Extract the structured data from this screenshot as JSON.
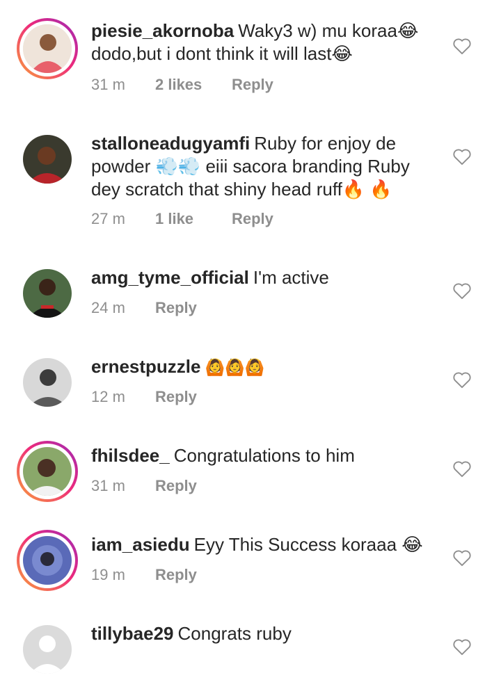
{
  "comments": [
    {
      "username": "piesie_akornoba",
      "text": "Waky3 w) mu koraa😂 dodo,but i dont think it will last😂",
      "time": "31 m",
      "likes": "2 likes",
      "reply": "Reply",
      "avatar_color": "#e8a87c",
      "story_ring": true
    },
    {
      "username": "stalloneadugyamfi",
      "text": "Ruby for enjoy de powder 💨💨 eiii sacora branding Ruby dey scratch that shiny head ruff🔥 🔥",
      "time": "27 m",
      "likes": "1 like",
      "reply": "Reply",
      "avatar_color": "#7a3a2a",
      "story_ring": false
    },
    {
      "username": "amg_tyme_official",
      "text": "I'm active",
      "time": "24 m",
      "reply": "Reply",
      "avatar_color": "#3f5a3a",
      "story_ring": false
    },
    {
      "username": "ernestpuzzle",
      "text": "🙆🙆🙆",
      "time": "12 m",
      "reply": "Reply",
      "avatar_color": "#9a9a9a",
      "story_ring": false
    },
    {
      "username": "fhilsdee_",
      "text": "Congratulations to him",
      "time": "31 m",
      "reply": "Reply",
      "avatar_color": "#5c4a3e",
      "story_ring": true
    },
    {
      "username": "iam_asiedu",
      "text": "Eyy This Success koraaa 😂",
      "time": "19 m",
      "reply": "Reply",
      "avatar_color": "#4a5aa8",
      "story_ring": true
    },
    {
      "username": "tillybae29",
      "text": "Congrats ruby",
      "avatar_color": "#dbdbdb",
      "story_ring": false
    }
  ],
  "icons": {
    "like": "heart-outline-icon"
  },
  "colors": {
    "primary_text": "#262626",
    "secondary_text": "#8e8e8e"
  }
}
